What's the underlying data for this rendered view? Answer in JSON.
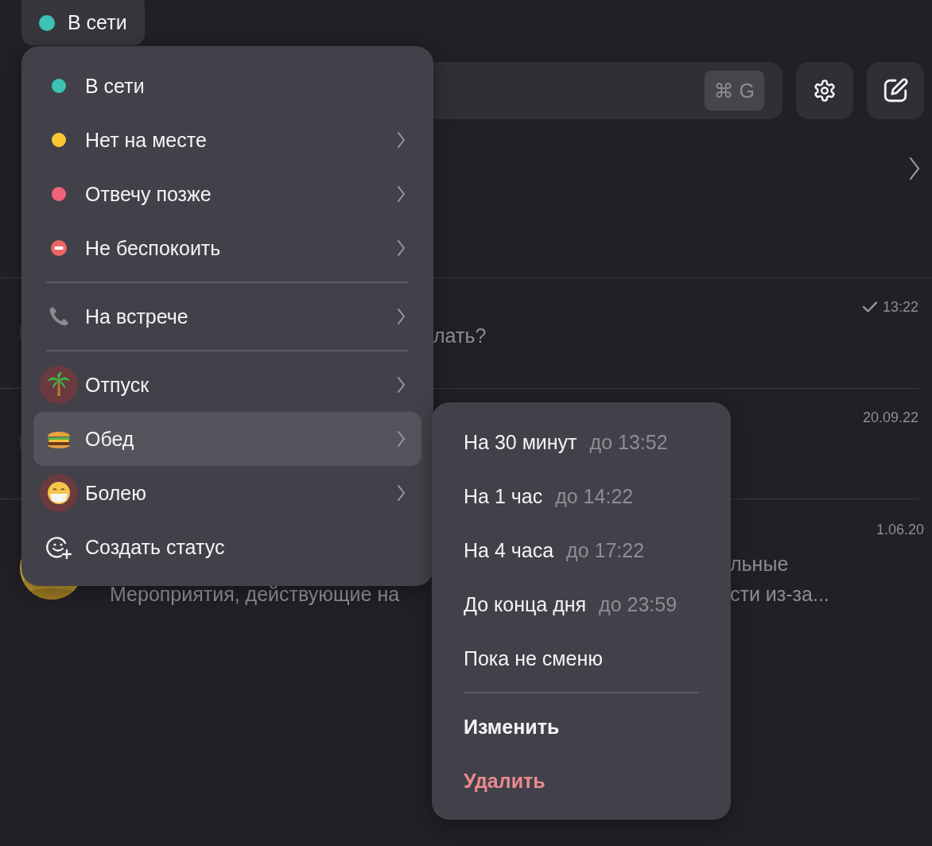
{
  "status_button": {
    "label": "В сети",
    "color": "#3cc3b4"
  },
  "search": {
    "shortcut": "⌘ G"
  },
  "chats": [
    {
      "time": "13:22",
      "read": true,
      "lines": [
        {
          "middle": "лать?"
        }
      ]
    },
    {
      "time": "20.09.22"
    },
    {
      "time": "1.06.20",
      "avatar": {
        "kind": "picture"
      },
      "lines": [
        {
          "right": "льные"
        },
        {
          "left": "Мероприятия, действующие на",
          "right": "сти из-за..."
        }
      ]
    }
  ],
  "status_menu": {
    "items": [
      {
        "kind": "dot",
        "color": "#3cc3b4",
        "label": "В сети",
        "has_submenu": false,
        "selected": false
      },
      {
        "kind": "dot",
        "color": "#f7c736",
        "label": "Нет на месте",
        "has_submenu": true,
        "selected": false
      },
      {
        "kind": "dot",
        "color": "#f0637a",
        "label": "Отвечу позже",
        "has_submenu": true,
        "selected": false
      },
      {
        "kind": "no-entry",
        "label": "Не беспокоить",
        "has_submenu": true,
        "selected": false
      },
      {
        "kind": "divider"
      },
      {
        "kind": "phone",
        "label": "На встрече",
        "has_submenu": true,
        "selected": false
      },
      {
        "kind": "divider"
      },
      {
        "kind": "palm",
        "label": "Отпуск",
        "has_submenu": true,
        "selected": false
      },
      {
        "kind": "burger",
        "label": "Обед",
        "has_submenu": true,
        "selected": true
      },
      {
        "kind": "mask",
        "label": "Болею",
        "has_submenu": true,
        "selected": false
      },
      {
        "kind": "create",
        "label": "Создать статус",
        "has_submenu": false,
        "selected": false
      }
    ]
  },
  "submenu": {
    "items": [
      {
        "kind": "duration",
        "label": "На 30 минут",
        "until": "до 13:52"
      },
      {
        "kind": "duration",
        "label": "На 1 час",
        "until": "до 14:22"
      },
      {
        "kind": "duration",
        "label": "На 4 часа",
        "until": "до 17:22"
      },
      {
        "kind": "duration",
        "label": "До конца дня",
        "until": "до 23:59"
      },
      {
        "kind": "duration",
        "label": "Пока не сменю"
      },
      {
        "kind": "divider"
      },
      {
        "kind": "edit",
        "label": "Изменить"
      },
      {
        "kind": "delete",
        "label": "Удалить"
      }
    ]
  }
}
